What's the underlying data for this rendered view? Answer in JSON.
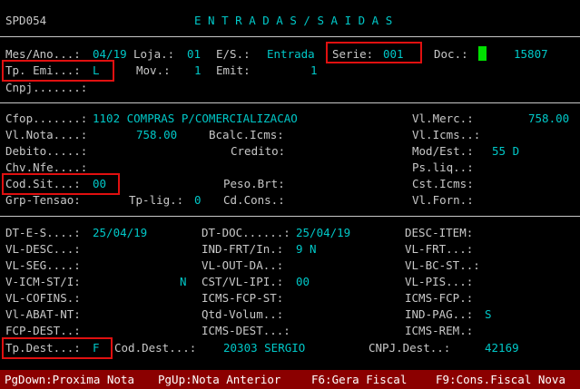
{
  "header": {
    "program": "SPD054",
    "title": "E N T R A D A S / S A I D A S"
  },
  "top": {
    "mes_ano_label": "Mes/Ano...:",
    "mes_ano_value": "04/19",
    "loja_label": "Loja.:",
    "loja_value": "01",
    "es_label": "E/S.:",
    "es_value": "Entrada",
    "serie_label": "Serie:",
    "serie_value": "001",
    "doc_label": "Doc.:",
    "doc_value": "15807",
    "tp_emi_label": "Tp. Emi...:",
    "tp_emi_value": "L",
    "mov_label": "Mov.:",
    "mov_value": "1",
    "emit_label": "Emit:",
    "emit_value": "1",
    "cnpj_label": "Cnpj.......:"
  },
  "mid": {
    "cfop_label": "Cfop.......:",
    "cfop_value": "1102 COMPRAS P/COMERCIALIZACAO",
    "vl_merc_label": "Vl.Merc.:",
    "vl_merc_value": "758.00",
    "vl_nota_label": "Vl.Nota....:",
    "vl_nota_value": "758.00",
    "bcalc_icms_label": "Bcalc.Icms:",
    "vl_icms_label": "Vl.Icms..:",
    "debito_label": "Debito.....:",
    "credito_label": "Credito:",
    "mod_est_label": "Mod/Est.:",
    "mod_est_value": "55 D",
    "chv_nfe_label": "Chv.Nfe....:",
    "ps_liq_label": "Ps.liq..:",
    "cod_sit_label": "Cod.Sit...:",
    "cod_sit_value": "00",
    "peso_brt_label": "Peso.Brt:",
    "cst_icms_label": "Cst.Icms:",
    "grp_tensao_label": "Grp-Tensao:",
    "tp_lig_label": "Tp-lig.:",
    "tp_lig_value": "0",
    "cd_cons_label": "Cd.Cons.:",
    "vl_forn_label": "Vl.Forn.:"
  },
  "bottom": {
    "dt_es_label": "DT-E-S....:",
    "dt_es_value": "25/04/19",
    "dt_doc_label": "DT-DOC......:",
    "dt_doc_value": "25/04/19",
    "desc_item_label": "DESC-ITEM:",
    "vl_desc_label": "VL-DESC...:",
    "ind_frt_label": "IND-FRT/In.:",
    "ind_frt_value": "9 N",
    "vl_frt_label": "VL-FRT...:",
    "vl_seg_label": "VL-SEG....:",
    "vl_out_da_label": "VL-OUT-DA..:",
    "vl_bc_st_label": "VL-BC-ST..:",
    "v_icm_st_label": "V-ICM-ST/I:",
    "v_icm_st_value": "N",
    "cst_vl_ipi_label": "CST/VL-IPI.:",
    "cst_vl_ipi_value": "00",
    "vl_pis_label": "VL-PIS...:",
    "vl_cofins_label": "VL-COFINS.:",
    "icms_fcp_st_label": "ICMS-FCP-ST:",
    "icms_fcp_label": "ICMS-FCP.:",
    "vl_abat_nt_label": "Vl-ABAT-NT:",
    "qtd_volum_label": "Qtd-Volum..:",
    "ind_pag_label": "IND-PAG..:",
    "ind_pag_value": "S",
    "fcp_dest_label": "FCP-DEST..:",
    "icms_dest_label": "ICMS-DEST...:",
    "icms_rem_label": "ICMS-REM.:",
    "tp_dest_label": "Tp.Dest...:",
    "tp_dest_value": "F",
    "cod_dest_label": "Cod.Dest...:",
    "cod_dest_value": "20303 SERGIO",
    "cnpj_dest_label": "CNPJ.Dest..:",
    "cnpj_dest_value": "42169"
  },
  "status_bar": {
    "pgdown": "PgDown:Proxima Nota",
    "pgup": "PgUp:Nota Anterior",
    "f6": "F6:Gera Fiscal",
    "f9": "F9:Cons.Fiscal Nova"
  },
  "colors": {
    "background": "#000000",
    "value": "#00c8c8",
    "label": "#c8c8c8",
    "highlight_box": "#e01010",
    "cursor": "#00e000",
    "status_bar": "#8b0000"
  }
}
